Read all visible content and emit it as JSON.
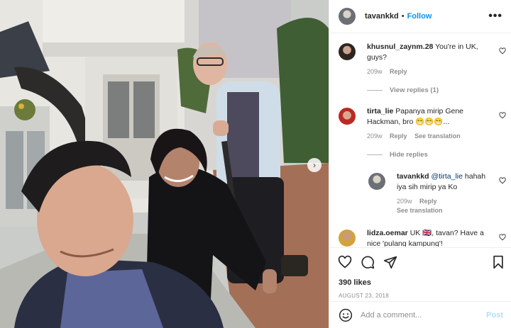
{
  "header": {
    "username": "tavankkd",
    "separator": "•",
    "follow_label": "Follow",
    "more_icon": "more-horizontal-icon",
    "more_label": "•••"
  },
  "photo": {
    "next_icon": "chevron-right-icon",
    "next_label": "›"
  },
  "comments": [
    {
      "username": "khusnul_zaynm.28",
      "text": "You're in UK, guys?",
      "age": "209w",
      "reply_label": "Reply",
      "view_replies": "View replies (1)"
    },
    {
      "username": "tirta_lie",
      "text": "Papanya mirip Gene Hackman, bro 😁😁😁...",
      "age": "209w",
      "reply_label": "Reply",
      "translation_label": "See translation",
      "hide_replies": "Hide replies"
    },
    {
      "username": "tavankkd",
      "mention": "@tirta_lie",
      "text": "hahah iya sih mirip ya Ko",
      "age": "209w",
      "reply_label": "Reply",
      "translation_label": "See translation"
    },
    {
      "username": "lidza.oemar",
      "text": "UK 🇬🇧, tavan? Have a nice 'pulang kampung'!"
    }
  ],
  "actions": {
    "like_icon": "heart-icon",
    "comment_icon": "comment-icon",
    "share_icon": "send-icon",
    "save_icon": "bookmark-icon"
  },
  "likes": "390 likes",
  "date": "AUGUST 23, 2018",
  "add_comment": {
    "emoji_icon": "emoji-smile-icon",
    "placeholder": "Add a comment...",
    "post_label": "Post"
  },
  "colors": {
    "accent": "#0095f6",
    "post_disabled": "#b2dffc",
    "meta": "#8e8e8e"
  }
}
